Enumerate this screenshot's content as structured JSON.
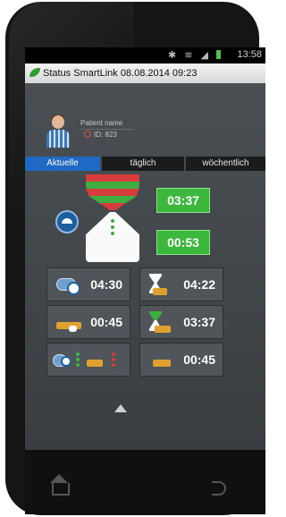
{
  "status_bar": {
    "time": "13:58",
    "icons": [
      "bluetooth-icon",
      "wifi-icon",
      "signal-icon",
      "battery-icon"
    ]
  },
  "title": {
    "text": "Status SmartLink 08.08.2014 09:23"
  },
  "profile": {
    "name": "Patient name",
    "id": "ID: 823"
  },
  "tabs": [
    {
      "label": "Aktuelle",
      "active": true
    },
    {
      "label": "täglich",
      "active": false
    },
    {
      "label": "wöchentlich",
      "active": false
    }
  ],
  "timers": {
    "top": "03:37",
    "bottom": "00:53"
  },
  "tiles": [
    {
      "value": "04:30",
      "icon": "pump-clock-icon"
    },
    {
      "value": "04:22",
      "icon": "hourglass-bed-icon"
    },
    {
      "value": "00:45",
      "icon": "bed-cup-icon"
    },
    {
      "value": "03:37",
      "icon": "hourglass-bed-green-icon"
    },
    {
      "value": "",
      "icon": "status-summary-icon"
    },
    {
      "value": "00:45",
      "icon": "bed-icon"
    }
  ],
  "colors": {
    "accent": "#1f69c4",
    "green": "#3cb83c",
    "red": "#d93c3c",
    "bed": "#e0a030"
  }
}
